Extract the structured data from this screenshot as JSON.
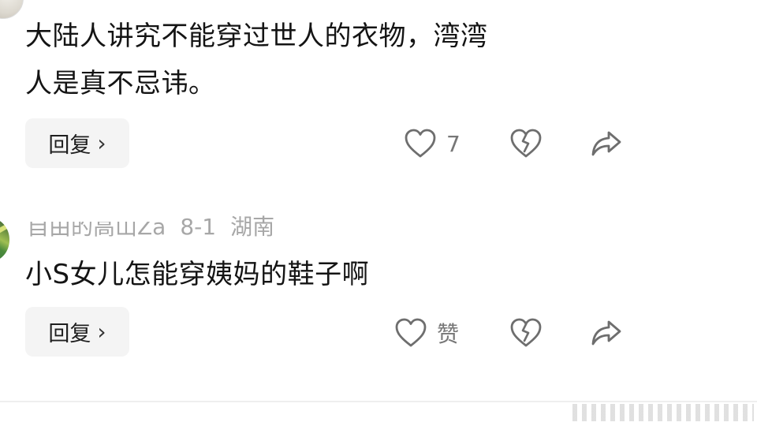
{
  "comments": [
    {
      "text_line1": "大陆人讲究不能穿过世人的衣物，湾湾",
      "text_line2": "人是真不忌讳。",
      "reply_label": "回复",
      "like_count": "7"
    },
    {
      "username": "自由的高山Za",
      "date": "8-1",
      "location": "湖南",
      "text": "小S女儿怎能穿姨妈的鞋子啊",
      "reply_label": "回复",
      "like_label": "赞"
    }
  ],
  "icons": {
    "like": "heart-outline-icon",
    "dislike": "broken-heart-icon",
    "share": "share-arrow-icon",
    "reply_chevron": "chevron-right-icon"
  },
  "colors": {
    "text_primary": "#141414",
    "meta": "#a7a7a7",
    "reply_bg": "#f4f4f4",
    "icon": "#6e6e6e"
  }
}
